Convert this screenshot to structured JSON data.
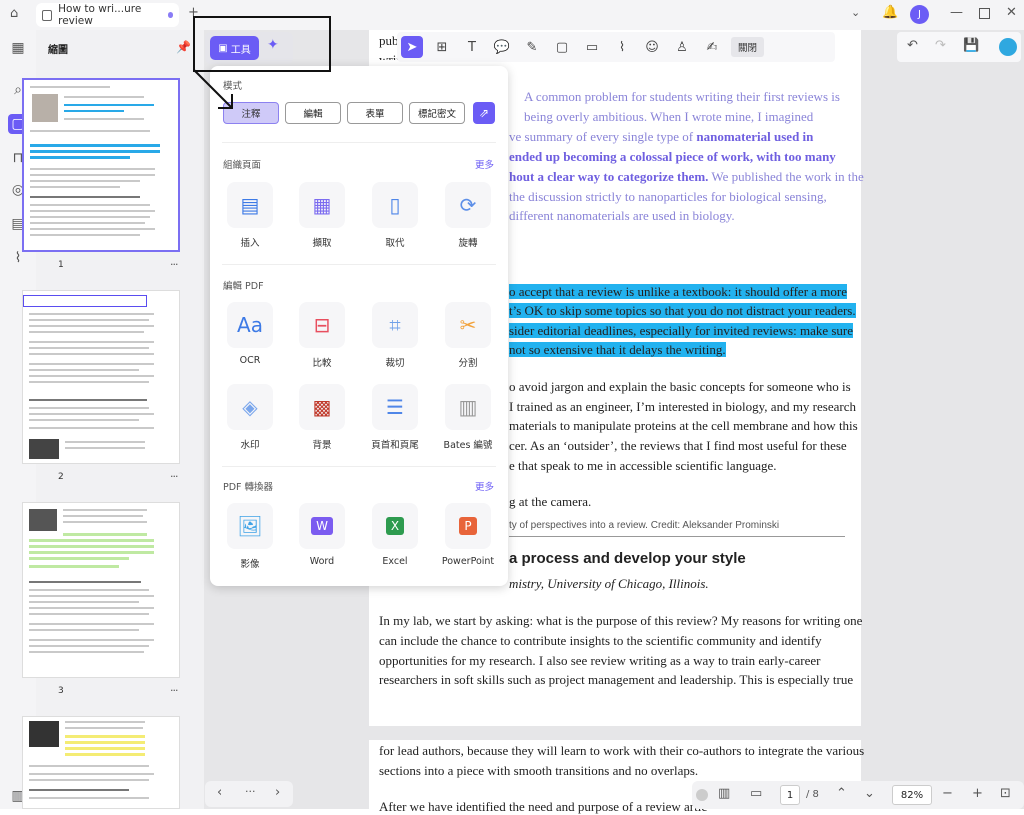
{
  "titlebar": {
    "tab_title": "How to wri...ure review",
    "avatar_letter": "J"
  },
  "panel": {
    "title": "縮圖",
    "page_numbers": [
      "1",
      "2",
      "3"
    ],
    "more": "···"
  },
  "toolbar": {
    "close_label": "關閉"
  },
  "tools_popup": {
    "mode_label": "模式",
    "modes": [
      "注釋",
      "編輯",
      "表單",
      "標記密文"
    ],
    "section_organize": "組織頁面",
    "section_edit": "編輯 PDF",
    "section_convert": "PDF 轉換器",
    "more_label": "更多",
    "organize_tools": [
      "插入",
      "擷取",
      "取代",
      "旋轉"
    ],
    "edit_tools_row1": [
      "OCR",
      "比較",
      "裁切",
      "分割"
    ],
    "edit_tools_row2": [
      "水印",
      "背景",
      "頁首和頁尾",
      "Bates 編號"
    ],
    "convert_tools": [
      "影像",
      "Word",
      "Excel",
      "PowerPoint"
    ],
    "tools_button_label": "工具"
  },
  "document": {
    "l1": "pub",
    "l2": "writing that I both",
    "p1": "A common problem for students writing their first reviews is",
    "p2": "being overly ambitious. When I wrote mine, I imagined",
    "p3a": "ve summary of every single type of ",
    "p3b": "nanomaterial used in",
    "p4a": "ended up  becoming a colossal piece of work, with too many",
    "p5a": "hout a clear way to categorize them.",
    "p5b": " We  published the work in the",
    "p6": "the  discussion strictly to nanoparticles for biological sensing,",
    "p7": "different nanomaterials are used in biology.",
    "h1": "o accept that a review is unlike a textbook: it should offer a more",
    "h2": "t’s OK to skip some topics so that you do not distract your readers.",
    "h3": "sider editorial deadlines, especially for invited reviews: make sure",
    "h4": "not so extensive that it delays the writing.",
    "b1": "o avoid jargon and explain the basic concepts for someone who is",
    "b2": "I trained as an engineer, I’m interested in biology, and my research",
    "b3": "materials to manipulate proteins at the cell membrane and how this",
    "b4": "cer. As an ‘outsider’, the reviews that I find most useful for these",
    "b5": "e that speak to me in accessible scientific language.",
    "c1": "g at the camera.",
    "c2": "ty of perspectives into a review.  Credit: Aleksander Prominski",
    "head": "a process and develop your style",
    "sub": "mistry, University of Chicago, Illinois.",
    "m1": "In my lab, we start by asking: what is the purpose of this review? My reasons for writing one",
    "m2": "can include the chance to contribute insights to the scientific community and identify",
    "m3": "opportunities for my research. I also see review writing as a way to train early-career",
    "m4": "researchers in soft skills such as project management and leadership. This is especially true",
    "n1": "for lead authors, because they will learn to work with their co-authors to integrate the various",
    "n2": "sections into a piece with smooth transitions and no overlaps.",
    "n3": "After we have identified the need and purpose of a review artic"
  },
  "bottom": {
    "page_current": "1",
    "page_total": "/ 8",
    "zoom": "82%",
    "nav_dots": "···"
  },
  "colors": {
    "accent": "#6b5cf5",
    "highlight": "#22b2ef"
  }
}
